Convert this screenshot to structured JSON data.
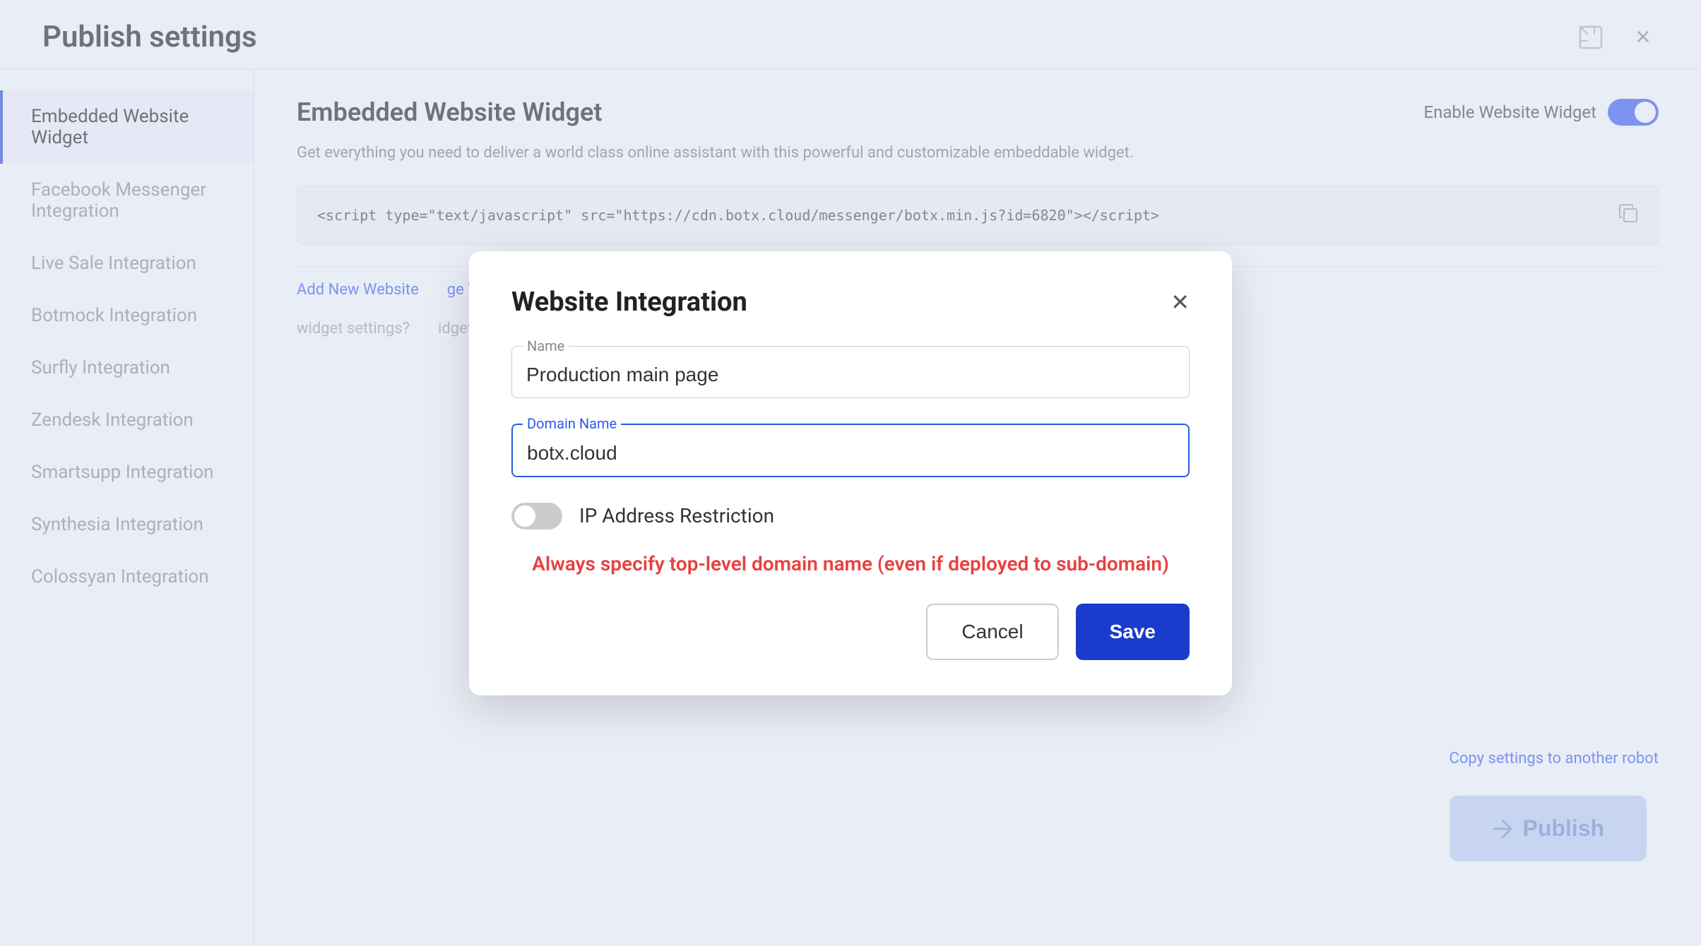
{
  "page": {
    "title": "Publish settings",
    "header_icons": {
      "resize": "⬜",
      "close": "✕"
    }
  },
  "sidebar": {
    "items": [
      {
        "id": "embedded-website",
        "label": "Embedded Website Widget",
        "active": true
      },
      {
        "id": "facebook",
        "label": "Facebook Messenger Integration",
        "active": false
      },
      {
        "id": "live-sale",
        "label": "Live Sale Integration",
        "active": false
      },
      {
        "id": "botmock",
        "label": "Botmock Integration",
        "active": false
      },
      {
        "id": "surfly",
        "label": "Surfly Integration",
        "active": false
      },
      {
        "id": "zendesk",
        "label": "Zendesk Integration",
        "active": false
      },
      {
        "id": "smartsupp",
        "label": "Smartsupp Integration",
        "active": false
      },
      {
        "id": "synthesia",
        "label": "Synthesia Integration",
        "active": false
      },
      {
        "id": "colossyan",
        "label": "Colossyan Integration",
        "active": false
      }
    ]
  },
  "main": {
    "section_title": "Embedded Website Widget",
    "toggle_label": "Enable Website Widget",
    "description": "Get everything you need to deliver a world class online assistant with this powerful and customizable embeddable widget.",
    "code_snippet": "<script type=\"text/javascript\" src=\"https://cdn.botx.cloud/messenger/botx.min.js?id=6820\"><\\/script>",
    "add_website_link": "Add New Website",
    "manage_websites_link": "ge Websites",
    "widget_settings_note": "widget settings?",
    "widget_editor_note": "idget Editor",
    "copy_settings_link": "Copy settings to another robot",
    "publish_button": "Publish"
  },
  "modal": {
    "title": "Website Integration",
    "close_icon": "✕",
    "name_label": "Name",
    "name_value": "Production main page",
    "domain_label": "Domain Name",
    "domain_value": "botx.cloud",
    "ip_restriction_label": "IP Address Restriction",
    "warning_text": "Always specify top-level domain name (even if deployed to sub-domain)",
    "cancel_button": "Cancel",
    "save_button": "Save"
  }
}
